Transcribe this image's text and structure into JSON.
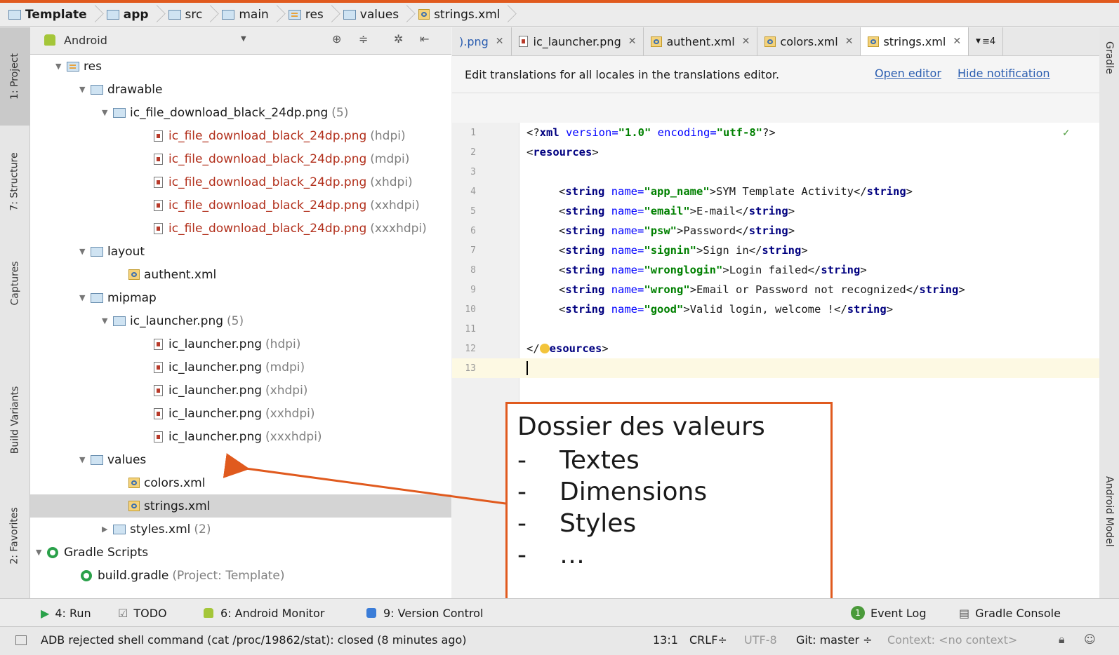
{
  "breadcrumb": [
    "Template",
    "app",
    "src",
    "main",
    "res",
    "values",
    "strings.xml"
  ],
  "left_tabs": [
    "1: Project",
    "7: Structure",
    "Captures",
    "Build Variants",
    "2: Favorites"
  ],
  "right_tabs": [
    "Gradle",
    "Android Model"
  ],
  "panel": {
    "view": "Android"
  },
  "tree": {
    "res": "res",
    "drawable": "drawable",
    "dl_group": "ic_file_download_black_24dp.png",
    "dl_group_count": "(5)",
    "dl_name": "ic_file_download_black_24dp.png",
    "q": [
      "(hdpi)",
      "(mdpi)",
      "(xhdpi)",
      "(xxhdpi)",
      "(xxxhdpi)"
    ],
    "layout": "layout",
    "authent": "authent.xml",
    "mipmap": "mipmap",
    "launcher_group": "ic_launcher.png",
    "launcher_count": "(5)",
    "launcher_name": "ic_launcher.png",
    "values": "values",
    "colors": "colors.xml",
    "strings": "strings.xml",
    "styles": "styles.xml",
    "styles_count": "(2)",
    "gradle_scripts": "Gradle Scripts",
    "build_gradle": "build.gradle",
    "build_gradle_note": "(Project: Template)"
  },
  "tabs": [
    {
      "label": ").png",
      "icon": "none"
    },
    {
      "label": "ic_launcher.png",
      "icon": "png"
    },
    {
      "label": "authent.xml",
      "icon": "xml"
    },
    {
      "label": "colors.xml",
      "icon": "xml"
    },
    {
      "label": "strings.xml",
      "icon": "xml"
    }
  ],
  "tab_overflow": "≡4",
  "notification": {
    "text": "Edit translations for all locales in the translations editor.",
    "open": "Open editor",
    "hide": "Hide notification"
  },
  "code": {
    "line_numbers": [
      "1",
      "2",
      "3",
      "4",
      "5",
      "6",
      "7",
      "8",
      "9",
      "10",
      "11",
      "12",
      "13"
    ],
    "l1_a": "<?",
    "l1_b": "xml",
    "l1_c": " version=",
    "l1_d": "\"1.0\"",
    "l1_e": " encoding=",
    "l1_f": "\"utf-8\"",
    "l1_g": "?>",
    "res_open": "resources",
    "strings": [
      {
        "name": "\"app_name\"",
        "value": "SYM Template Activity"
      },
      {
        "name": "\"email\"",
        "value": "E-mail"
      },
      {
        "name": "\"psw\"",
        "value": "Password"
      },
      {
        "name": "\"signin\"",
        "value": "Sign in"
      },
      {
        "name": "\"wronglogin\"",
        "value": "Login failed"
      },
      {
        "name": "\"wrong\"",
        "value": "Email or Password not recognized"
      },
      {
        "name": "\"good\"",
        "value": "Valid login, welcome !"
      }
    ],
    "res_close": "esources"
  },
  "bottom_tools": {
    "run": "4: Run",
    "todo": "TODO",
    "monitor": "6: Android Monitor",
    "vcs": "9: Version Control",
    "eventlog": "Event Log",
    "eventlog_count": "1",
    "gradle_console": "Gradle Console"
  },
  "status": {
    "message": "ADB rejected shell command (cat /proc/19862/stat): closed (8 minutes ago)",
    "position": "13:1",
    "line_sep": "CRLF÷",
    "encoding": "UTF-8",
    "git": "Git: master ÷",
    "context": "Context: <no context>"
  },
  "callout": {
    "title": "Dossier des valeurs",
    "items": [
      "Textes",
      "Dimensions",
      "Styles",
      "…"
    ],
    "dash": "-"
  },
  "colors": {
    "accent": "#e05a1e",
    "link": "#2a5db0",
    "error_file": "#b2301c"
  }
}
